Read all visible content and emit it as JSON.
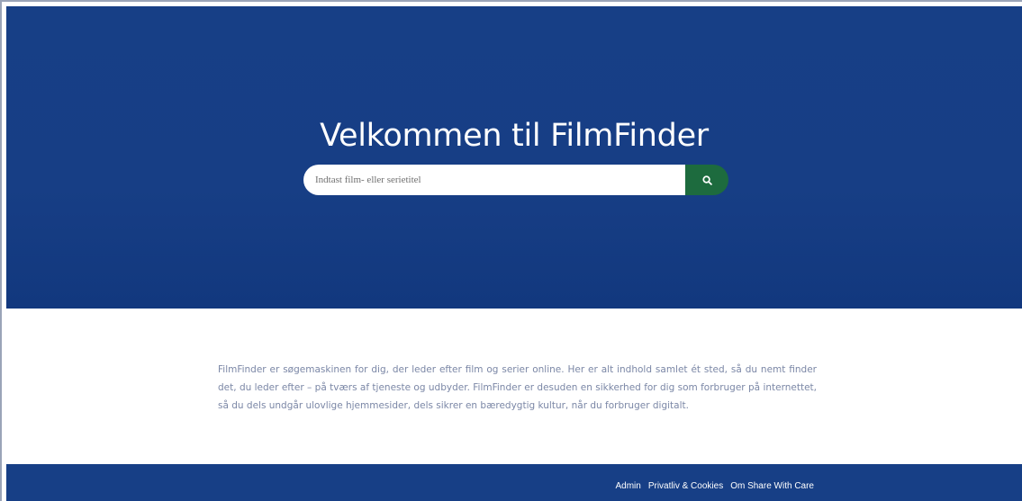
{
  "hero": {
    "title": "Velkommen til FilmFinder"
  },
  "search": {
    "placeholder": "Indtast film- eller serietitel",
    "value": "",
    "button_icon": "search-icon",
    "button_color": "#1d6b3e"
  },
  "intro": {
    "text": "FilmFinder er søgemaskinen for dig, der leder efter film og serier online. Her er alt indhold samlet ét sted, så du nemt finder det, du leder efter – på tværs af tjeneste og udbyder. FilmFinder er desuden en sikkerhed for dig som forbruger på internettet, så du dels undgår ulovlige hjemmesider, dels sikrer en bæredygtig kultur, når du forbruger digitalt."
  },
  "footer": {
    "links": [
      {
        "label": "Admin"
      },
      {
        "label": "Privatliv & Cookies"
      },
      {
        "label": "Om Share With Care"
      }
    ]
  },
  "colors": {
    "brand_blue": "#173f86",
    "accent_green": "#1d6b3e",
    "body_text": "#7b87a6"
  }
}
